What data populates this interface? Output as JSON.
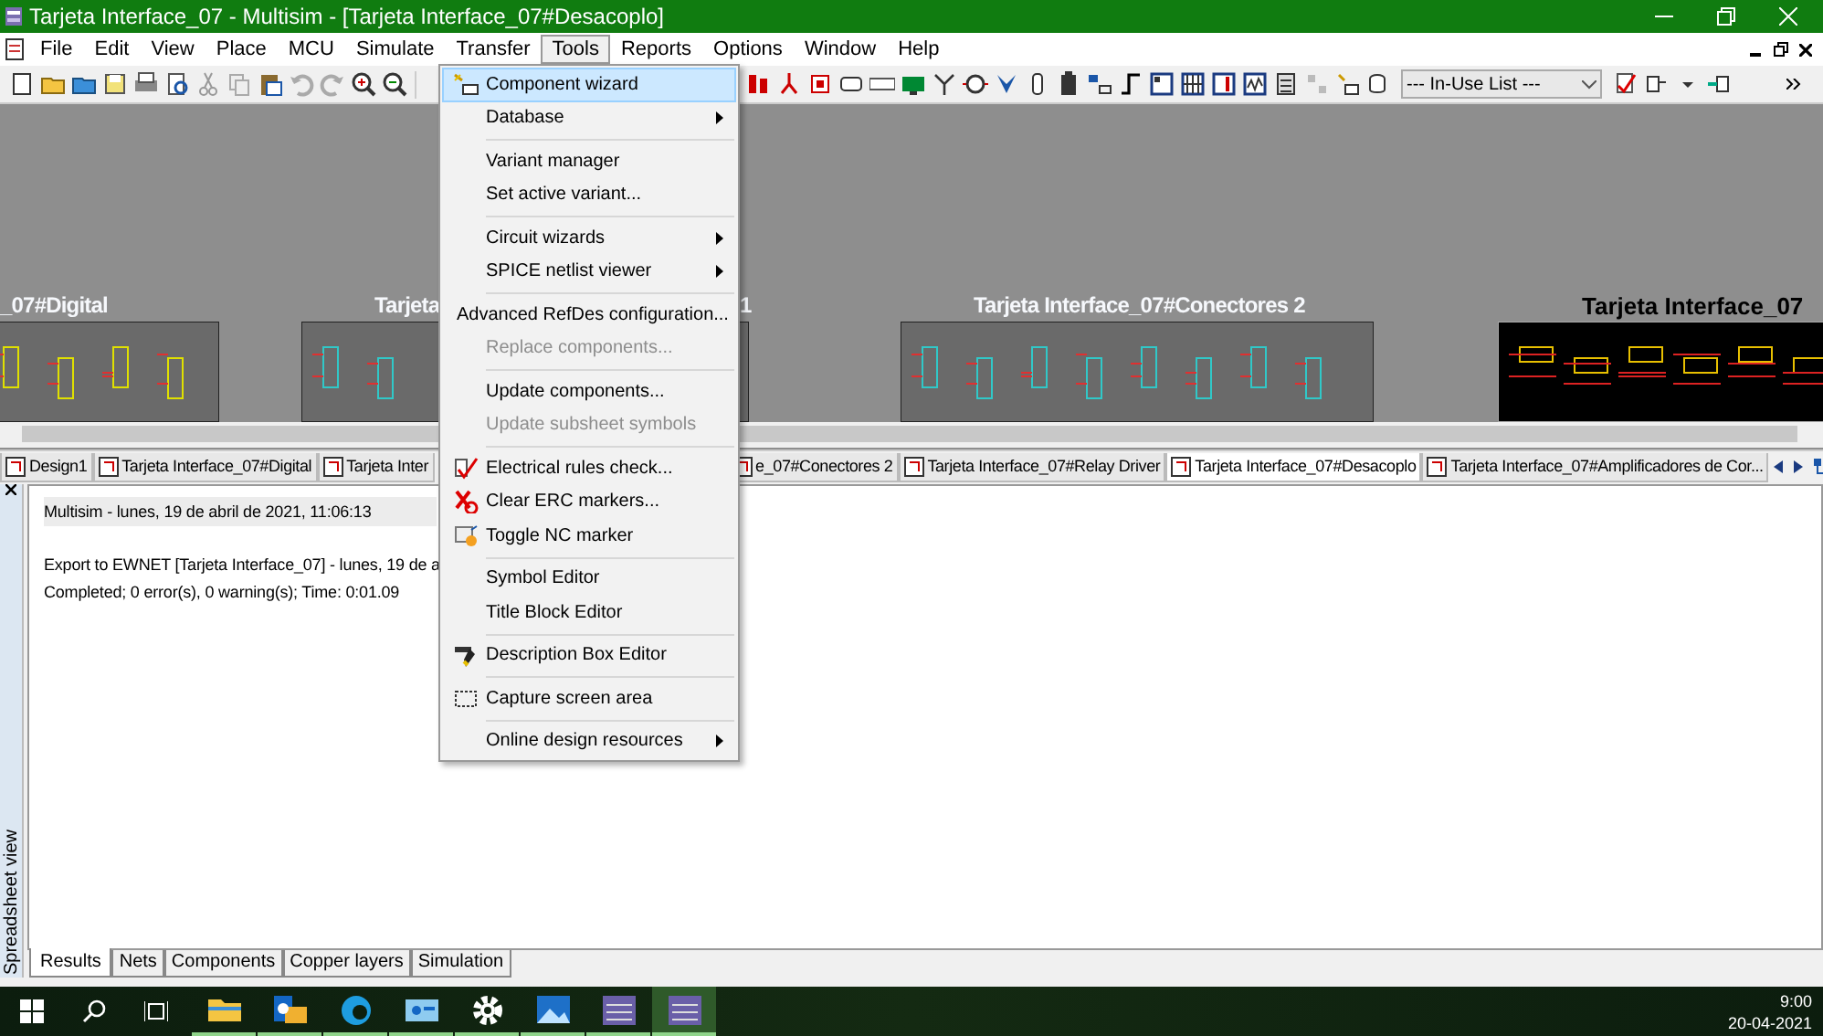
{
  "window": {
    "title": "Tarjeta Interface_07 - Multisim - [Tarjeta Interface_07#Desacoplo]"
  },
  "menubar": {
    "items": [
      {
        "label": "File",
        "selected": false
      },
      {
        "label": "Edit",
        "selected": false
      },
      {
        "label": "View",
        "selected": false
      },
      {
        "label": "Place",
        "selected": false
      },
      {
        "label": "MCU",
        "selected": false
      },
      {
        "label": "Simulate",
        "selected": false
      },
      {
        "label": "Transfer",
        "selected": false
      },
      {
        "label": "Tools",
        "selected": true
      },
      {
        "label": "Reports",
        "selected": false
      },
      {
        "label": "Options",
        "selected": false
      },
      {
        "label": "Window",
        "selected": false
      },
      {
        "label": "Help",
        "selected": false
      }
    ]
  },
  "toolbar": {
    "dropdown": {
      "value": "--- In-Use List ---"
    }
  },
  "canvas": {
    "sheets": [
      {
        "label": "_07#Digital",
        "selected": false
      },
      {
        "label": "Tarjeta",
        "selected": false
      },
      {
        "label": "1",
        "selected": false
      },
      {
        "label": "Tarjeta Interface_07#Conectores 2",
        "selected": false
      },
      {
        "label": "Tarjeta Interface_07",
        "selected": true
      }
    ]
  },
  "sheet_tabs": [
    {
      "label": "Design1",
      "selected": false
    },
    {
      "label": "Tarjeta Interface_07#Digital",
      "selected": false
    },
    {
      "label": "Tarjeta Inter",
      "selected": false
    },
    {
      "label": "e_07#Conectores 2",
      "selected": false
    },
    {
      "label": "Tarjeta Interface_07#Relay Driver",
      "selected": false
    },
    {
      "label": "Tarjeta Interface_07#Desacoplo",
      "selected": true
    },
    {
      "label": "Tarjeta Interface_07#Amplificadores de Cor...",
      "selected": false
    }
  ],
  "results": {
    "side_label": "Spreadsheet view",
    "header": "Multisim  -  lunes, 19 de abril de 2021, 11:06:13",
    "lines": [
      "Export to EWNET [Tarjeta Interface_07]  - lunes, 19 de a",
      "Completed;  0 error(s), 0 warning(s);  Time: 0:01.09"
    ],
    "tabs": [
      {
        "label": "Results",
        "selected": true
      },
      {
        "label": "Nets",
        "selected": false
      },
      {
        "label": "Components",
        "selected": false
      },
      {
        "label": "Copper layers",
        "selected": false
      },
      {
        "label": "Simulation",
        "selected": false
      }
    ]
  },
  "tools_menu": {
    "groups": [
      [
        {
          "label": "Component wizard",
          "selected": true,
          "disabled": false,
          "submenu": false
        },
        {
          "label": "Database",
          "selected": false,
          "disabled": false,
          "submenu": true
        }
      ],
      [
        {
          "label": "Variant manager",
          "selected": false,
          "disabled": false,
          "submenu": false
        },
        {
          "label": "Set active variant...",
          "selected": false,
          "disabled": false,
          "submenu": false
        }
      ],
      [
        {
          "label": "Circuit wizards",
          "selected": false,
          "disabled": false,
          "submenu": true
        },
        {
          "label": "SPICE netlist viewer",
          "selected": false,
          "disabled": false,
          "submenu": true
        }
      ],
      [
        {
          "label": "Advanced RefDes configuration...",
          "selected": false,
          "disabled": false,
          "submenu": false
        },
        {
          "label": "Replace components...",
          "selected": false,
          "disabled": true,
          "submenu": false
        }
      ],
      [
        {
          "label": "Update components...",
          "selected": false,
          "disabled": false,
          "submenu": false
        },
        {
          "label": "Update subsheet symbols",
          "selected": false,
          "disabled": true,
          "submenu": false
        }
      ],
      [
        {
          "label": "Electrical rules check...",
          "selected": false,
          "disabled": false,
          "submenu": false
        },
        {
          "label": "Clear ERC markers...",
          "selected": false,
          "disabled": false,
          "submenu": false
        },
        {
          "label": "Toggle NC marker",
          "selected": false,
          "disabled": false,
          "submenu": false
        }
      ],
      [
        {
          "label": "Symbol Editor",
          "selected": false,
          "disabled": false,
          "submenu": false
        },
        {
          "label": "Title Block Editor",
          "selected": false,
          "disabled": false,
          "submenu": false
        }
      ],
      [
        {
          "label": "Description Box Editor",
          "selected": false,
          "disabled": false,
          "submenu": false
        }
      ],
      [
        {
          "label": "Capture screen area",
          "selected": false,
          "disabled": false,
          "submenu": false
        }
      ],
      [
        {
          "label": "Online design resources",
          "selected": false,
          "disabled": false,
          "submenu": true
        }
      ]
    ]
  },
  "taskbar": {
    "apps": [
      {
        "selected": false
      },
      {
        "selected": false
      },
      {
        "selected": false
      },
      {
        "selected": false
      },
      {
        "selected": false
      },
      {
        "selected": false
      },
      {
        "selected": false
      },
      {
        "selected": true
      }
    ],
    "time": "9:00",
    "date": "20-04-2021"
  }
}
